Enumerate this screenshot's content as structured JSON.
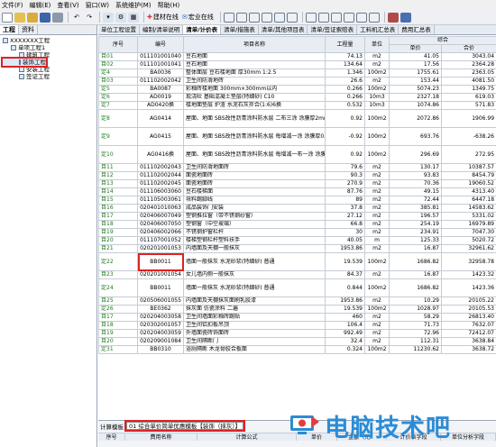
{
  "menu": [
    "文件(F)",
    "编辑(E)",
    "查看(V)",
    "窗口(W)",
    "系统维护(M)",
    "帮助(H)"
  ],
  "toolbar": {
    "online_label": "建材在线",
    "forum_label": "宏业在线"
  },
  "left_panel": {
    "tabs": [
      "工程",
      "资料"
    ],
    "tree": [
      {
        "label": "XXXXXXX工程",
        "indent": 0
      },
      {
        "label": "单项工程1",
        "indent": 1
      },
      {
        "label": "建筑工程",
        "indent": 2
      },
      {
        "label": "装饰工程",
        "indent": 2,
        "selected": true
      },
      {
        "label": "安装工程",
        "indent": 2
      },
      {
        "label": "签证工程",
        "indent": 2
      }
    ]
  },
  "subtabs": [
    "单位工程设置",
    "编制/清单说明",
    "清单/计价表",
    "清单/措施表",
    "清单/其他项目表",
    "清单/签证索赔表",
    "工料机汇总表",
    "费用汇总表"
  ],
  "active_subtab": 2,
  "columns": {
    "seq": "序号",
    "code": "编号",
    "name": "项目名称",
    "qty": "工程量",
    "unit": "单位",
    "total_group": "综合",
    "unit_price": "单价",
    "total_price": "合价"
  },
  "rows": [
    {
      "type": "q",
      "no": "目01",
      "code": "011101001040",
      "name": "豆石地面",
      "qty": "74.13",
      "unit": "m2",
      "price": "41.05",
      "total": "3043.04"
    },
    {
      "type": "q",
      "no": "目02",
      "code": "011101001041",
      "name": "豆石地面",
      "qty": "134.64",
      "unit": "m2",
      "price": "17.56",
      "total": "2364.28"
    },
    {
      "type": "d",
      "no": "定4",
      "code": "BA0036",
      "name": "整体面层 豆石楼地面 厚30mm 1:2.5",
      "qty": "1.346",
      "unit": "100m2",
      "price": "1755.61",
      "total": "2363.05"
    },
    {
      "type": "q",
      "no": "目03",
      "code": "011102002042",
      "name": "卫生间防滑地砖",
      "qty": "26.6",
      "unit": "m2",
      "price": "153.44",
      "total": "4081.50"
    },
    {
      "type": "d",
      "no": "定5",
      "code": "BA0087",
      "name": "彩釉砖楼地面 300mm×300mm以内",
      "qty": "0.266",
      "unit": "100m2",
      "price": "5074.23",
      "total": "1349.75"
    },
    {
      "type": "d",
      "no": "定6",
      "code": "AD0019",
      "name": "现浇砼 基础混凝土垫层(特细砂) C10",
      "qty": "0.266",
      "unit": "10m3",
      "price": "2327.18",
      "total": "619.03"
    },
    {
      "type": "d",
      "no": "定7",
      "code": "AD0420换",
      "name": "楼地面垫层 炉渣 水泥石灰拌合(1:6)6换",
      "qty": "0.532",
      "unit": "10m3",
      "price": "1074.86",
      "total": "571.83"
    },
    {
      "type": "d",
      "tall": true,
      "no": "定8",
      "code": "AG0414",
      "name": "屋面、地面 SBS改性沥青涂料防水层 二布三涂 涂膜厚2mm",
      "qty": "0.92",
      "unit": "100m2",
      "price": "2072.86",
      "total": "1906.99"
    },
    {
      "type": "d",
      "tall": true,
      "no": "定9",
      "code": "AG0415",
      "name": "屋面、地面 SBS改性沥青涂料防水层 每增减一涂 涂膜厚0.6mm",
      "qty": "-0.92",
      "unit": "100m2",
      "price": "693.76",
      "total": "-638.26"
    },
    {
      "type": "d",
      "tall": true,
      "no": "定10",
      "code": "AG0416换",
      "name": "屋面、地面 SBS改性沥青涂料防水层 每增减一布一涂 涂膜厚0.1mm[单价]×2, 综合费×2",
      "qty": "0.92",
      "unit": "100m2",
      "price": "296.69",
      "total": "272.95"
    },
    {
      "type": "q",
      "no": "目11",
      "code": "011102002043",
      "name": "卫生间防滑地面砖",
      "qty": "79.6",
      "unit": "m2",
      "price": "130.17",
      "total": "10387.57"
    },
    {
      "type": "q",
      "no": "目12",
      "code": "011102002044",
      "name": "面瓷地面砖",
      "qty": "90.3",
      "unit": "m2",
      "price": "93.83",
      "total": "8454.79"
    },
    {
      "type": "q",
      "no": "目13",
      "code": "011102002045",
      "name": "面瓷地面砖",
      "qty": "270.9",
      "unit": "m2",
      "price": "70.36",
      "total": "19060.52"
    },
    {
      "type": "q",
      "no": "目14",
      "code": "011106003060",
      "name": "豆石楼梯面",
      "qty": "87.76",
      "unit": "m2",
      "price": "49.15",
      "total": "4313.40"
    },
    {
      "type": "q",
      "no": "目15",
      "code": "011105003061",
      "name": "块料踢脚线",
      "qty": "89",
      "unit": "m2",
      "price": "72.44",
      "total": "6447.18"
    },
    {
      "type": "q",
      "no": "目16",
      "code": "020401010063",
      "name": "成品装饰门安装",
      "qty": "37.8",
      "unit": "m2",
      "price": "385.81",
      "total": "14583.62"
    },
    {
      "type": "q",
      "no": "目17",
      "code": "020406007049",
      "name": "塑钢推拉窗（带不锈钢纱窗）",
      "qty": "27.12",
      "unit": "m2",
      "price": "196.57",
      "total": "5331.02"
    },
    {
      "type": "q",
      "no": "目18",
      "code": "020406007050",
      "name": "塑钢窗（中空玻璃）",
      "qty": "66.8",
      "unit": "m2",
      "price": "254.19",
      "total": "16979.89"
    },
    {
      "type": "q",
      "no": "目19",
      "code": "020406002066",
      "name": "不锈钢护窗栏杆",
      "qty": "30",
      "unit": "m2",
      "price": "234.91",
      "total": "7047.30"
    },
    {
      "type": "q",
      "no": "目20",
      "code": "011107001052",
      "name": "楼梯塑钢栏杆塑料扶手",
      "qty": "40.05",
      "unit": "m",
      "price": "125.33",
      "total": "5020.72"
    },
    {
      "type": "q",
      "no": "目21",
      "code": "020201001053",
      "name": "内墙面及天棚一般抹灰",
      "qty": "1953.86",
      "unit": "m2",
      "price": "16.87",
      "total": "32961.62"
    },
    {
      "type": "d",
      "tall": true,
      "hl": true,
      "no": "定22",
      "code": "BB0011",
      "name": "墙面一般抹灰 水泥砂浆(特细砂) 普通",
      "qty": "19.539",
      "unit": "100m2",
      "price": "1686.82",
      "total": "32958.78"
    },
    {
      "type": "q",
      "no": "目23",
      "code": "020201001054",
      "name": "女儿墙内侧一般抹灰",
      "qty": "84.37",
      "unit": "m2",
      "price": "16.87",
      "total": "1423.32"
    },
    {
      "type": "d",
      "tall": true,
      "no": "定24",
      "code": "BB0011",
      "name": "墙面一般抹灰 水泥砂浆(特细砂) 普通",
      "qty": "0.844",
      "unit": "100m2",
      "price": "1686.82",
      "total": "1423.36"
    },
    {
      "type": "q",
      "no": "目25",
      "code": "020506001055",
      "name": "内墙面及天棚抹灰面刷乳胶漆",
      "qty": "1953.86",
      "unit": "m2",
      "price": "10.29",
      "total": "20105.22"
    },
    {
      "type": "d",
      "no": "定26",
      "code": "BE0362",
      "name": "抹灰面 仿瓷涂料 二遍",
      "qty": "19.539",
      "unit": "100m2",
      "price": "1028.97",
      "total": "20105.53"
    },
    {
      "type": "q",
      "no": "目17",
      "code": "020204003058",
      "name": "卫生间墙面彩釉砖踢贴",
      "qty": "460",
      "unit": "m2",
      "price": "58.29",
      "total": "26813.40"
    },
    {
      "type": "q",
      "no": "目18",
      "code": "020302001057",
      "name": "卫生间铝扣板吊顶",
      "qty": "106.4",
      "unit": "m2",
      "price": "71.73",
      "total": "7632.07"
    },
    {
      "type": "q",
      "no": "目19",
      "code": "020204003059",
      "name": "外墙面瓷砖饰面砖",
      "qty": "992.49",
      "unit": "m2",
      "price": "72.96",
      "total": "72412.07"
    },
    {
      "type": "q",
      "no": "目20",
      "code": "020209001084",
      "name": "卫生间隔断门",
      "qty": "32.4",
      "unit": "m2",
      "price": "112.31",
      "total": "3638.84"
    },
    {
      "type": "d",
      "no": "定31",
      "code": "BB0310",
      "name": "浴厕隔断 木龙骨胶合板面",
      "qty": "0.324",
      "unit": "100m2",
      "price": "11230.62",
      "total": "3638.72"
    }
  ],
  "calc": {
    "label": "计算模板",
    "template": "01 综合单价简单优惠模板【装饰（抹灰）】",
    "cols": [
      "序号",
      "费用名称",
      "计算公式",
      "单价",
      "金额（元）",
      "计价表字段",
      "单位分析字段"
    ]
  },
  "watermark": {
    "text": "电脑技术吧",
    "color": "#2b8cd6"
  }
}
